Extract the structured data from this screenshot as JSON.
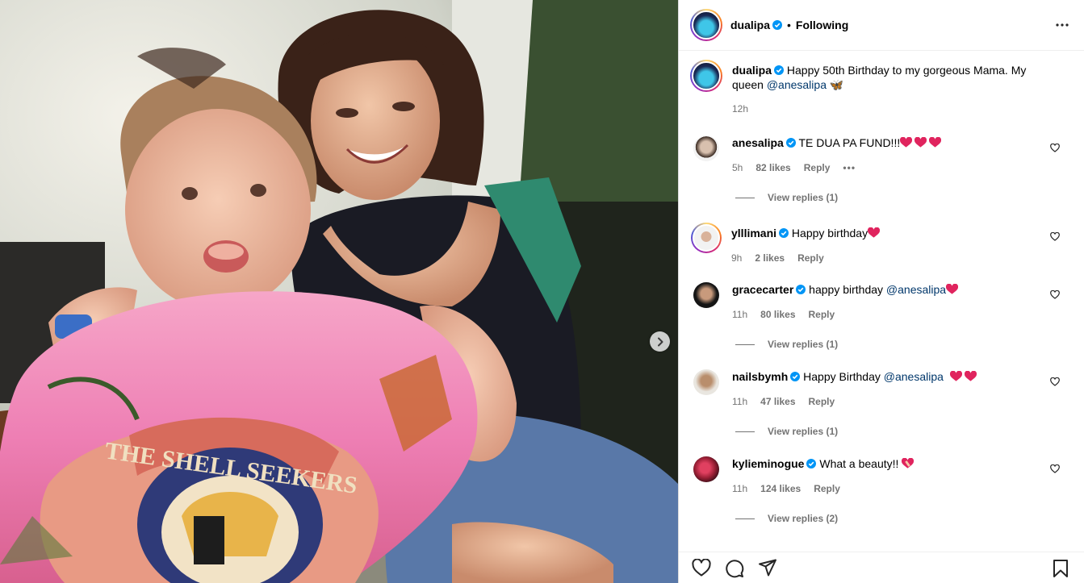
{
  "post": {
    "author": "dualipa",
    "separator": "•",
    "follow_status": "Following",
    "caption_text": "Happy 50th Birthday to my gorgeous Mama. My queen ",
    "caption_mention": "@anesalipa",
    "caption_emoji": "🦋",
    "time": "12h"
  },
  "comments": [
    {
      "user": "anesalipa",
      "verified": true,
      "text": "TE DUA PA FUND!!!",
      "hearts": 3,
      "time": "5h",
      "likes": "82 likes",
      "reply": "Reply",
      "more": "•••",
      "view_replies": "View replies (1)"
    },
    {
      "user": "ylllimani",
      "verified": true,
      "text": "Happy birthday",
      "hearts": 1,
      "time": "9h",
      "likes": "2 likes",
      "reply": "Reply"
    },
    {
      "user": "gracecarter",
      "verified": true,
      "text": "happy birthday ",
      "mention": "@anesalipa",
      "hearts": 1,
      "time": "11h",
      "likes": "80 likes",
      "reply": "Reply",
      "view_replies": "View replies (1)"
    },
    {
      "user": "nailsbymh",
      "verified": true,
      "text": "Happy Birthday ",
      "mention": "@anesalipa",
      "hearts": 2,
      "time": "11h",
      "likes": "47 likes",
      "reply": "Reply",
      "view_replies": "View replies (1)"
    },
    {
      "user": "kylieminogue",
      "verified": true,
      "text": "What a beauty!! ",
      "hearts": 1,
      "time": "11h",
      "likes": "124 likes",
      "reply": "Reply",
      "view_replies": "View replies (2)"
    }
  ],
  "icons": {
    "next": "chevron-right-icon",
    "more": "more-options-icon",
    "like": "heart-outline-icon",
    "comment": "comment-bubble-icon",
    "share": "paper-plane-icon",
    "save": "bookmark-icon",
    "verified": "verified-badge-icon"
  },
  "colors": {
    "verified": "#0095f6",
    "mention": "#00376b",
    "muted": "#737373",
    "heart": "#ed4956"
  }
}
